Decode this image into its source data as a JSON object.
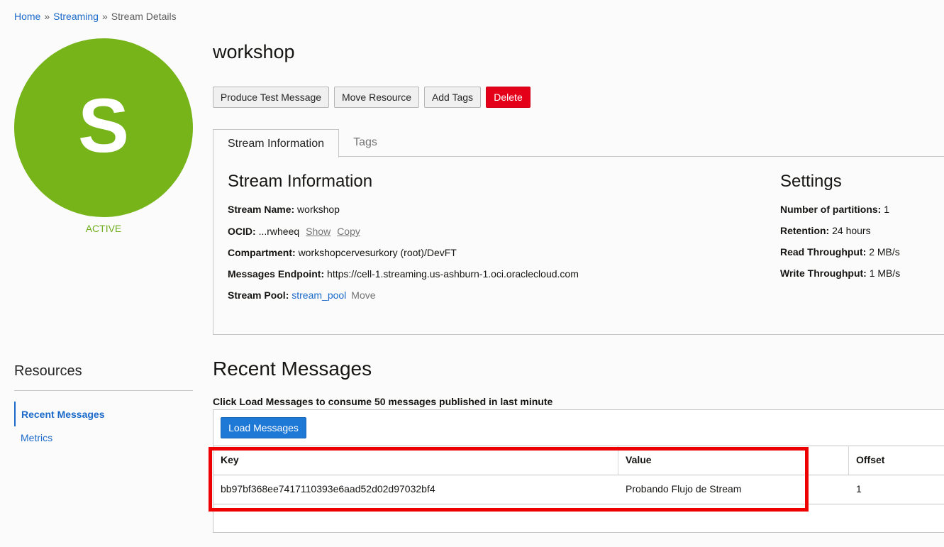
{
  "breadcrumb": {
    "home": "Home",
    "streaming": "Streaming",
    "current": "Stream Details",
    "separator": "»"
  },
  "avatar": {
    "letter": "S",
    "status": "ACTIVE",
    "color": "#76b41a"
  },
  "page": {
    "title": "workshop"
  },
  "actions": {
    "produce": "Produce Test Message",
    "move": "Move Resource",
    "tags": "Add Tags",
    "delete": "Delete"
  },
  "tabs": {
    "info": "Stream Information",
    "tags": "Tags"
  },
  "stream_info": {
    "heading": "Stream Information",
    "name_label": "Stream Name:",
    "name": "workshop",
    "ocid_label": "OCID:",
    "ocid": "...rwheeq",
    "show": "Show",
    "copy": "Copy",
    "compartment_label": "Compartment:",
    "compartment": "workshopcervesurkory (root)/DevFT",
    "endpoint_label": "Messages Endpoint:",
    "endpoint": "https://cell-1.streaming.us-ashburn-1.oci.oraclecloud.com",
    "pool_label": "Stream Pool:",
    "pool": "stream_pool",
    "pool_move": "Move"
  },
  "settings": {
    "heading": "Settings",
    "partitions_label": "Number of partitions:",
    "partitions": "1",
    "retention_label": "Retention:",
    "retention": "24 hours",
    "read_label": "Read Throughput:",
    "read": "2 MB/s",
    "write_label": "Write Throughput:",
    "write": "1 MB/s"
  },
  "resources": {
    "heading": "Resources",
    "items": [
      "Recent Messages",
      "Metrics"
    ]
  },
  "recent": {
    "heading": "Recent Messages",
    "hint": "Click Load Messages to consume 50 messages published in last minute",
    "load_button": "Load Messages",
    "columns": [
      "Key",
      "Value",
      "Offset"
    ],
    "rows": [
      {
        "key": "bb97bf368ee7417110393e6aad52d02d97032bf4",
        "value": "Probando Flujo de Stream",
        "offset": "1"
      }
    ]
  }
}
